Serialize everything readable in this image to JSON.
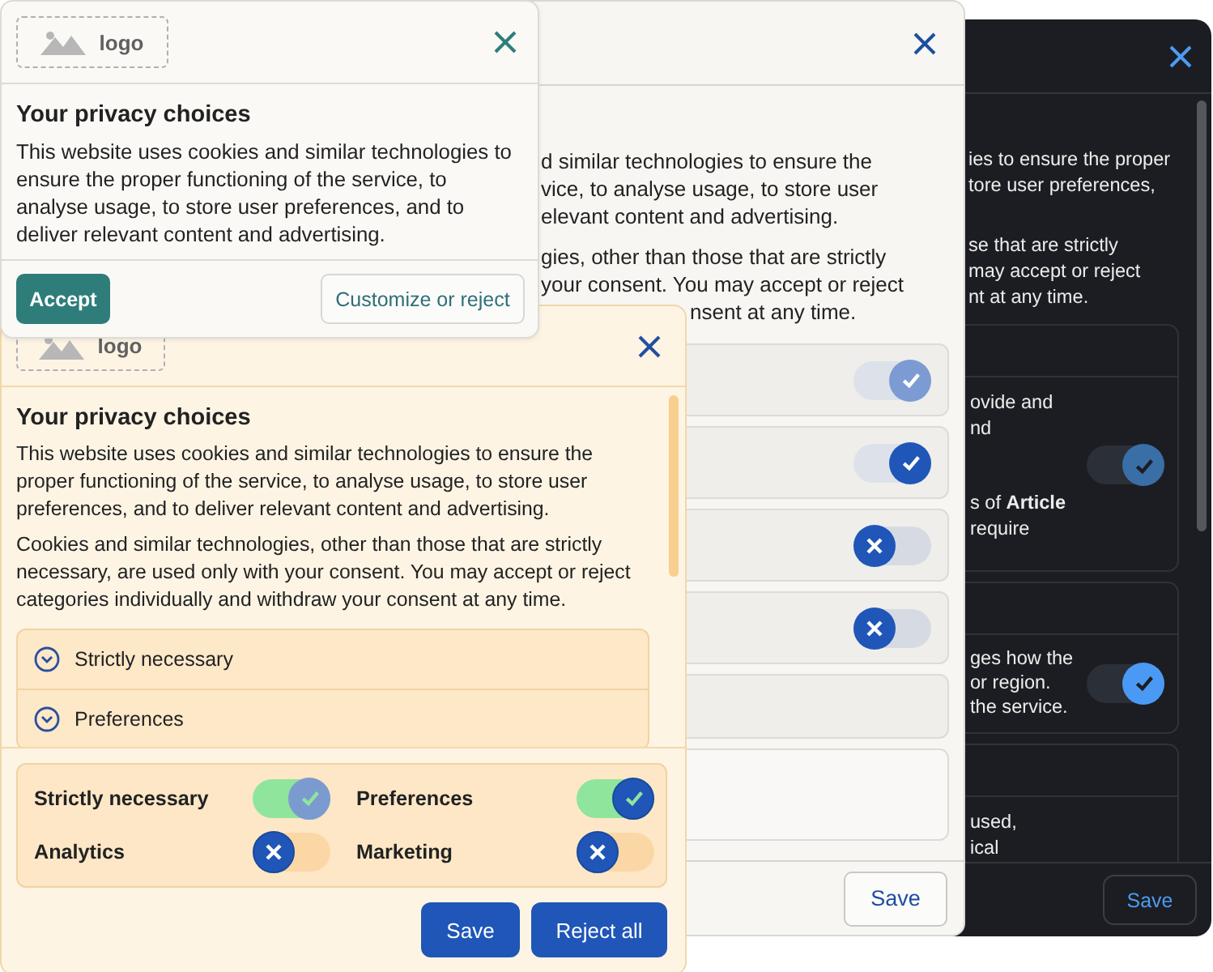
{
  "dark_dialog": {
    "intro": [
      [
        "ies to ensure the proper",
        "tore user preferences,"
      ],
      [
        "se that are strictly",
        "may accept or reject",
        "nt at any time."
      ]
    ],
    "cards": [
      {
        "paragraphs": [
          [
            "ovide and",
            "nd"
          ],
          [
            "s of **Article**",
            "require"
          ]
        ],
        "toggle": {
          "on": true,
          "disabled": true
        }
      },
      {
        "paragraphs": [
          [
            "ges how the",
            "or region.",
            "the service."
          ]
        ],
        "toggle": {
          "on": true,
          "disabled": false
        }
      },
      {
        "paragraphs": [
          [
            "used,",
            "ical"
          ]
        ]
      }
    ],
    "save_button": "Save"
  },
  "middle_dialog": {
    "intro": [
      [
        "d similar technologies to ensure the",
        "vice, to analyse usage, to store user",
        "elevant content and advertising."
      ],
      [
        "gies, other than those that are strictly",
        "your consent. You may accept or reject",
        "nsent at any time."
      ]
    ],
    "rows": [
      {
        "kind": "toggle",
        "on": true,
        "disabled": true
      },
      {
        "kind": "toggle",
        "on": true,
        "disabled": false
      },
      {
        "kind": "toggle",
        "on": false,
        "disabled": false
      },
      {
        "kind": "toggle",
        "on": false,
        "disabled": false
      },
      {
        "kind": "blank"
      },
      {
        "kind": "outlined"
      }
    ],
    "save_button": "Save"
  },
  "preferences_dialog": {
    "logo": "logo",
    "title": "Your privacy choices",
    "paragraphs": [
      "This website uses cookies and similar technologies to ensure the proper functioning of the service, to analyse usage, to store user preferences, and to deliver relevant content and advertising.",
      "Cookies and similar technologies, other than those that are strictly necessary, are used only with your consent. You may accept or reject categories individually and withdraw your consent at any time."
    ],
    "accordion": [
      {
        "label": "Strictly necessary",
        "expanded": false
      },
      {
        "label": "Preferences",
        "expanded": false
      }
    ],
    "toggles": [
      {
        "label": "Strictly necessary",
        "on": true,
        "disabled": true
      },
      {
        "label": "Preferences",
        "on": true,
        "disabled": false
      },
      {
        "label": "Analytics",
        "on": false,
        "disabled": false
      },
      {
        "label": "Marketing",
        "on": false,
        "disabled": false
      }
    ],
    "buttons": [
      "Save",
      "Reject all"
    ]
  },
  "banner": {
    "logo": "logo",
    "title": "Your privacy choices",
    "text": "This website uses cookies and similar technologies to ensure the proper functioning of the service, to analyse usage, to store user preferences, and to deliver relevant content and advertising.",
    "buttons": [
      {
        "label": "Accept",
        "kind": "primary"
      },
      {
        "label": "Customize or reject",
        "kind": "secondary"
      }
    ]
  }
}
